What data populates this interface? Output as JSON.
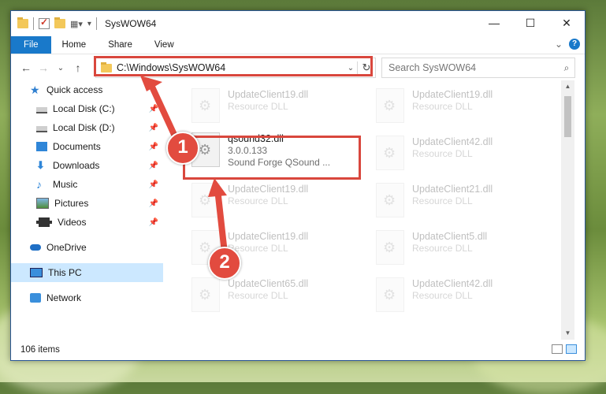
{
  "window": {
    "title": "SysWOW64",
    "controls": {
      "minimize": "—",
      "maximize": "☐",
      "close": "✕"
    }
  },
  "ribbon": {
    "tabs": [
      "File",
      "Home",
      "Share",
      "View"
    ],
    "expand": "⌄",
    "help": "?"
  },
  "nav": {
    "back": "←",
    "forward": "→",
    "recent": "⌄",
    "up": "↑",
    "address": "C:\\Windows\\SysWOW64",
    "address_dropdown": "⌄",
    "refresh": "↻",
    "search_placeholder": "Search SysWOW64"
  },
  "sidebar": {
    "quick_access": "Quick access",
    "items": [
      {
        "label": "Local Disk (C:)",
        "icon": "drive-icon"
      },
      {
        "label": "Local Disk (D:)",
        "icon": "drive-icon"
      },
      {
        "label": "Documents",
        "icon": "documents-icon"
      },
      {
        "label": "Downloads",
        "icon": "downloads-icon"
      },
      {
        "label": "Music",
        "icon": "music-icon"
      },
      {
        "label": "Pictures",
        "icon": "pictures-icon"
      },
      {
        "label": "Videos",
        "icon": "videos-icon"
      }
    ],
    "onedrive": "OneDrive",
    "this_pc": "This PC",
    "network": "Network"
  },
  "files": {
    "main": {
      "name": "qsound32.dll",
      "version": "3.0.0.133",
      "description": "Sound Forge QSound ..."
    },
    "faded_left": [
      {
        "name": "UpdateClient19.dll",
        "type": "Resource DLL"
      },
      {
        "name": "UpdateClient19.dll",
        "type": "Resource DLL"
      },
      {
        "name": "UpdateClient19.dll",
        "type": "Resource DLL"
      },
      {
        "name": "UpdateClient65.dll",
        "type": "Resource DLL"
      }
    ],
    "faded_right": [
      {
        "name": "UpdateClient19.dll",
        "type": "Resource DLL"
      },
      {
        "name": "UpdateClient42.dll",
        "type": "Resource DLL"
      },
      {
        "name": "UpdateClient21.dll",
        "type": "Resource DLL"
      },
      {
        "name": "UpdateClient5.dll",
        "type": "Resource DLL"
      },
      {
        "name": "UpdateClient42.dll",
        "type": "Resource DLL"
      }
    ]
  },
  "status": {
    "item_count": "106 items"
  },
  "annotations": {
    "step1": "1",
    "step2": "2",
    "color": "#e24b3f"
  }
}
